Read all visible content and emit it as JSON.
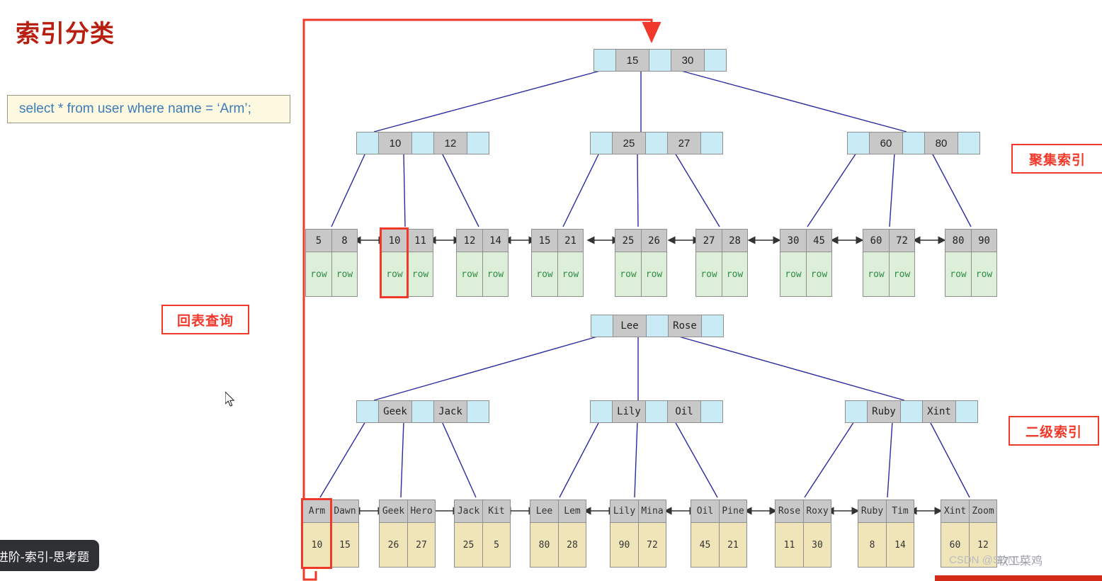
{
  "page": {
    "title": "索引分类"
  },
  "sql": {
    "query": "select * from user where name = ‘Arm’;"
  },
  "annotations": {
    "clustered_index": "聚集索引",
    "secondary_index": "二级索引",
    "back_to_table": "回表查询",
    "accent_color": "#f1392b"
  },
  "taskbar": {
    "label": "进阶-索引-思考题"
  },
  "watermark": {
    "text": "CSDN @SDNU",
    "author": "软工菜鸡"
  },
  "diagram_data": {
    "type": "b-plus-tree",
    "clustered_index": {
      "root": {
        "keys": [
          "15",
          "30"
        ]
      },
      "internal": [
        {
          "keys": [
            "10",
            "12"
          ]
        },
        {
          "keys": [
            "25",
            "27"
          ]
        },
        {
          "keys": [
            "60",
            "80"
          ]
        }
      ],
      "leaves": [
        {
          "keys": [
            "5",
            "8"
          ],
          "values": [
            "row",
            "row"
          ]
        },
        {
          "keys": [
            "10",
            "11"
          ],
          "values": [
            "row",
            "row"
          ],
          "highlight_index": 0
        },
        {
          "keys": [
            "12",
            "14"
          ],
          "values": [
            "row",
            "row"
          ]
        },
        {
          "keys": [
            "15",
            "21"
          ],
          "values": [
            "row",
            "row"
          ]
        },
        {
          "keys": [
            "25",
            "26"
          ],
          "values": [
            "row",
            "row"
          ]
        },
        {
          "keys": [
            "27",
            "28"
          ],
          "values": [
            "row",
            "row"
          ]
        },
        {
          "keys": [
            "30",
            "45"
          ],
          "values": [
            "row",
            "row"
          ]
        },
        {
          "keys": [
            "60",
            "72"
          ],
          "values": [
            "row",
            "row"
          ]
        },
        {
          "keys": [
            "80",
            "90"
          ],
          "values": [
            "row",
            "row"
          ]
        }
      ]
    },
    "secondary_index": {
      "root": {
        "keys": [
          "Lee",
          "Rose"
        ]
      },
      "internal": [
        {
          "keys": [
            "Geek",
            "Jack"
          ]
        },
        {
          "keys": [
            "Lily",
            "Oil"
          ]
        },
        {
          "keys": [
            "Ruby",
            "Xint"
          ]
        }
      ],
      "leaves": [
        {
          "keys": [
            "Arm",
            "Dawn"
          ],
          "values": [
            "10",
            "15"
          ],
          "highlight_index": 0
        },
        {
          "keys": [
            "Geek",
            "Hero"
          ],
          "values": [
            "26",
            "27"
          ]
        },
        {
          "keys": [
            "Jack",
            "Kit"
          ],
          "values": [
            "25",
            "5"
          ]
        },
        {
          "keys": [
            "Lee",
            "Lem"
          ],
          "values": [
            "80",
            "28"
          ]
        },
        {
          "keys": [
            "Lily",
            "Mina"
          ],
          "values": [
            "90",
            "72"
          ]
        },
        {
          "keys": [
            "Oil",
            "Pine"
          ],
          "values": [
            "45",
            "21"
          ]
        },
        {
          "keys": [
            "Rose",
            "Roxy"
          ],
          "values": [
            "11",
            "30"
          ]
        },
        {
          "keys": [
            "Ruby",
            "Tim"
          ],
          "values": [
            "8",
            "14"
          ]
        },
        {
          "keys": [
            "Xint",
            "Zoom"
          ],
          "values": [
            "60",
            "12"
          ]
        }
      ]
    },
    "colors": {
      "pointer_cell": "#c8ebf5",
      "key_cell": "#c8c8c8",
      "clustered_row_cell": "#ddefd8",
      "secondary_value_cell": "#f0e5b8",
      "edge": "#2b2b9e",
      "highlight": "#f1392b"
    }
  }
}
